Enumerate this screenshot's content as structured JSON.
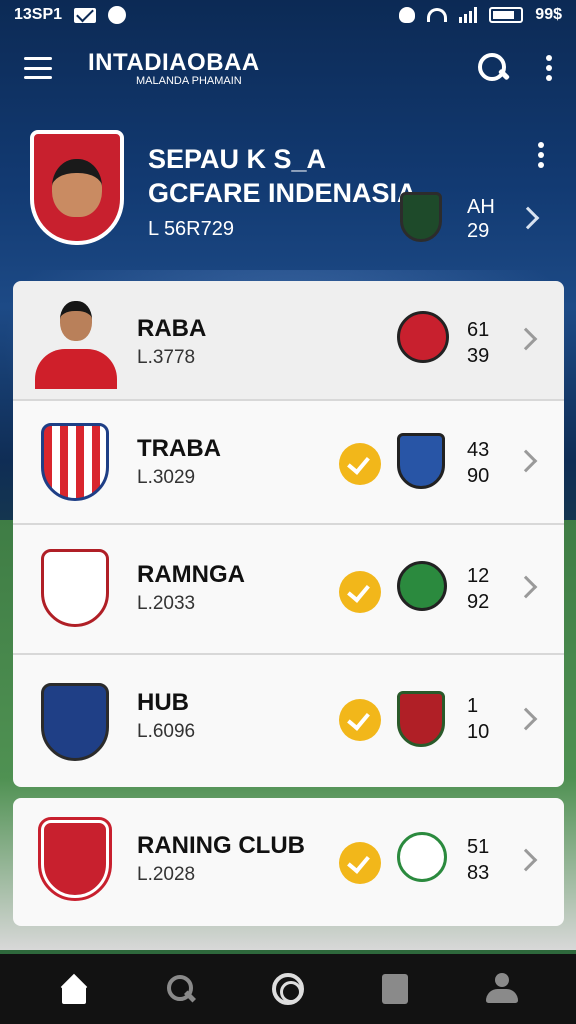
{
  "status_bar": {
    "time": "13SP1",
    "battery": "99$"
  },
  "app_bar": {
    "title": "INTADIAOBAA",
    "subtitle": "MALANDA PHAMAIN"
  },
  "hero": {
    "title_line1": "SEPAU K S_A",
    "title_line2": "GCFARE INDENASIA",
    "code": "L 56R729",
    "num_top": "AH",
    "num_bottom": "29"
  },
  "clubs": [
    {
      "name": "RABA",
      "code": "L.3778",
      "num_top": "61",
      "num_bottom": "39",
      "checked": false
    },
    {
      "name": "TRABA",
      "code": "L.3029",
      "num_top": "43",
      "num_bottom": "90",
      "checked": true
    },
    {
      "name": "RAMNGA",
      "code": "L.2033",
      "num_top": "12",
      "num_bottom": "92",
      "checked": true
    },
    {
      "name": "HUB",
      "code": "L.6096",
      "num_top": "1",
      "num_bottom": "10",
      "checked": true
    },
    {
      "name": "RANING CLUB",
      "code": "L.2028",
      "num_top": "51",
      "num_bottom": "83",
      "checked": true
    }
  ],
  "colors": {
    "accent": "#f2b71a",
    "primary": "#0c2a55",
    "badge_red": "#c8202e"
  },
  "icons": [
    "menu-icon",
    "search-icon",
    "more-vert-icon",
    "chevron-right-icon",
    "check-circle-icon",
    "home-icon",
    "search-nav-icon",
    "circle-nav-icon",
    "bookmark-icon",
    "profile-icon"
  ]
}
